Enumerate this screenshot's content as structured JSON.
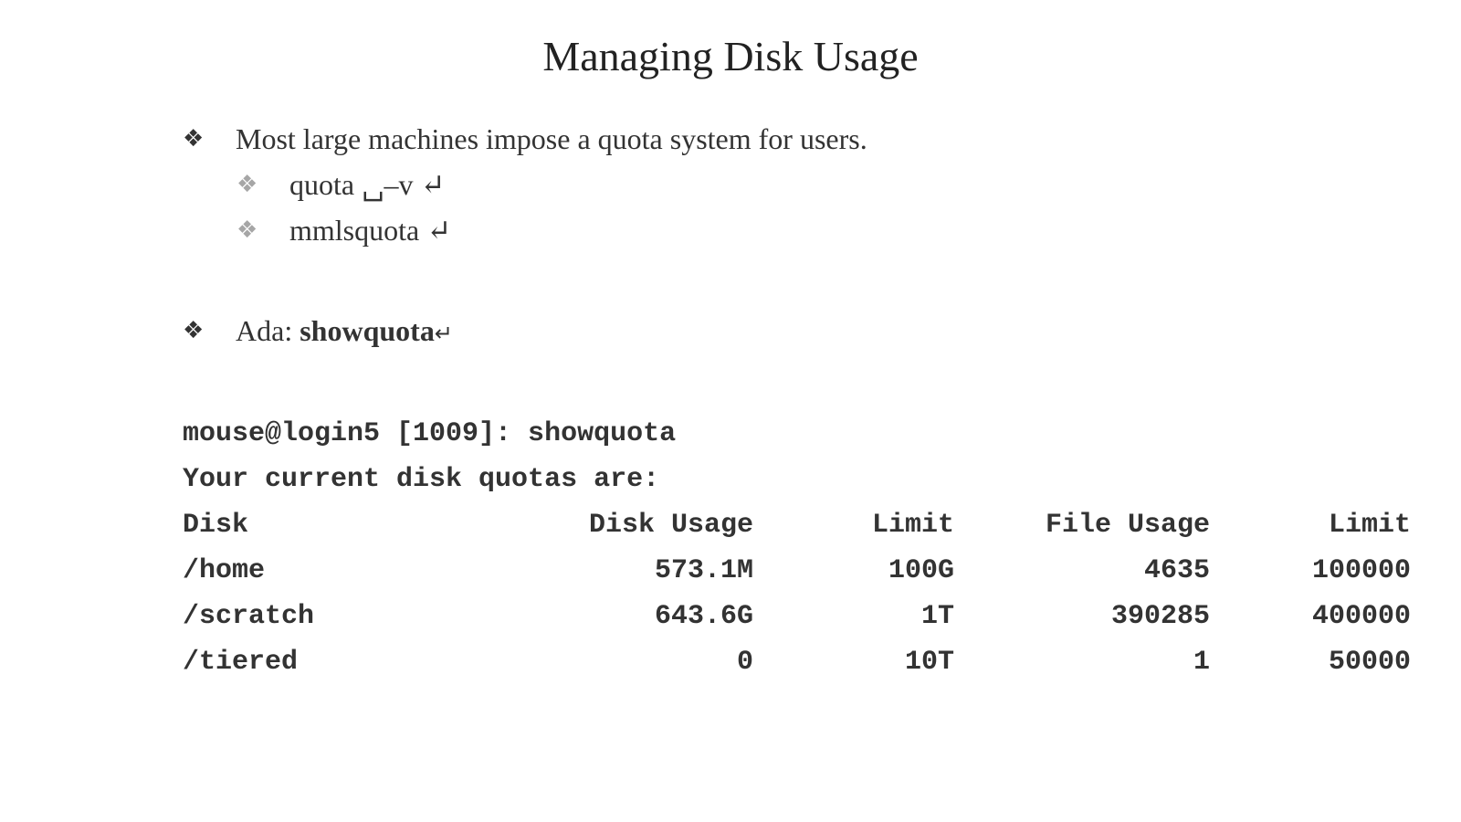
{
  "slide": {
    "title": "Managing Disk Usage"
  },
  "bullets": {
    "marker": "❖",
    "item1": "Most large machines impose a quota system for users.",
    "sub1": "quota ␣–v ↵",
    "sub2": "mmlsquota ↵",
    "item2_prefix": "Ada: ",
    "item2_command": "showquota",
    "item2_suffix": "↵"
  },
  "terminal": {
    "prompt_line": "mouse@login5 [1009]: showquota",
    "intro_line": "Your current disk quotas are:",
    "columns": [
      "Disk",
      "Disk Usage",
      "Limit",
      "File Usage",
      "Limit"
    ],
    "rows": [
      [
        "/home",
        "573.1M",
        "100G",
        "4635",
        "100000"
      ],
      [
        "/scratch",
        "643.6G",
        "1T",
        "390285",
        "400000"
      ],
      [
        "/tiered",
        "0",
        "10T",
        "1",
        "50000"
      ]
    ]
  }
}
